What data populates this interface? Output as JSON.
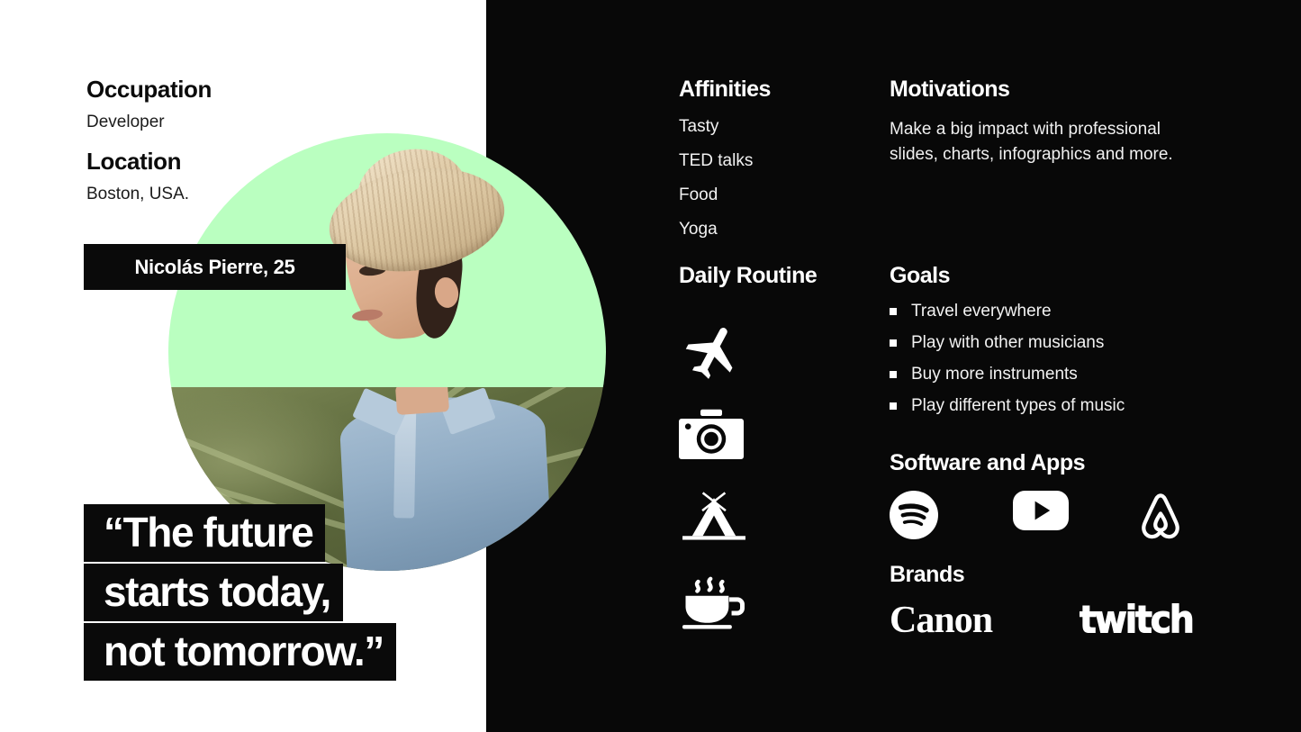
{
  "left": {
    "occupation_label": "Occupation",
    "occupation_value": "Developer",
    "location_label": "Location",
    "location_value": "Boston, USA.",
    "name_bar": "Nicolás Pierre, 25",
    "quote_lines": [
      "“The future",
      "starts today,",
      "not tomorrow.”"
    ]
  },
  "affinities": {
    "heading": "Affinities",
    "items": [
      "Tasty",
      "TED talks",
      "Food",
      "Yoga"
    ]
  },
  "motivations": {
    "heading": "Motivations",
    "text": "Make a big impact with professional slides, charts, infographics and more."
  },
  "daily_routine": {
    "heading": "Daily Routine",
    "icons": [
      "airplane-icon",
      "camera-icon",
      "tent-icon",
      "coffee-cup-icon"
    ]
  },
  "goals": {
    "heading": "Goals",
    "items": [
      "Travel everywhere",
      "Play with other musicians",
      "Buy more instruments",
      "Play different types of music"
    ]
  },
  "software": {
    "heading": "Software  and Apps",
    "logos": [
      "spotify-logo",
      "youtube-logo",
      "airbnb-logo"
    ]
  },
  "brands": {
    "heading": "Brands",
    "logos": [
      {
        "name": "canon-logo",
        "text": "Canon"
      },
      {
        "name": "twitch-logo",
        "text": "twitch"
      }
    ]
  },
  "colors": {
    "background_light": "#ffffff",
    "background_dark": "#080808",
    "accent_green": "#baffc0",
    "text_on_dark": "#ffffff",
    "text_on_light": "#0b0b0b"
  }
}
